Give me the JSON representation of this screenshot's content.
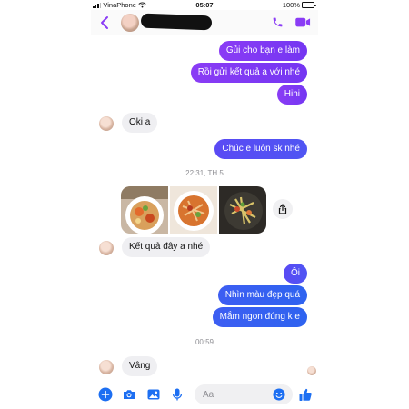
{
  "status_bar": {
    "carrier": "VinaPhone",
    "time": "05:07",
    "battery": "100%"
  },
  "header": {
    "contact_name": ""
  },
  "messages": [
    {
      "dir": "out",
      "text": "Gủi cho bạn e làm"
    },
    {
      "dir": "out",
      "text": "Rồi gửi kết quả a với nhé"
    },
    {
      "dir": "out",
      "text": "Hihi"
    },
    {
      "dir": "in",
      "text": "Oki a"
    },
    {
      "dir": "out",
      "text": "Chúc e luôn sk nhé"
    },
    {
      "dir": "in",
      "text": "Kết quả đây a nhé"
    },
    {
      "dir": "out",
      "text": "Ôi"
    },
    {
      "dir": "out",
      "text": "Nhìn màu đẹp quá"
    },
    {
      "dir": "out",
      "text": "Mắm ngon đúng k e"
    },
    {
      "dir": "in",
      "text": "Vâng"
    }
  ],
  "timestamps": [
    "22:31, TH 5",
    "00:59"
  ],
  "photos": [
    "food-photo-1",
    "food-photo-2",
    "food-photo-3"
  ],
  "composer": {
    "placeholder": "Aa"
  },
  "colors": {
    "messenger_purple": "#7b3af5",
    "messenger_blue": "#2f63f0",
    "incoming_bubble": "#efeff2",
    "icon_accent": "#1d6ff2"
  }
}
